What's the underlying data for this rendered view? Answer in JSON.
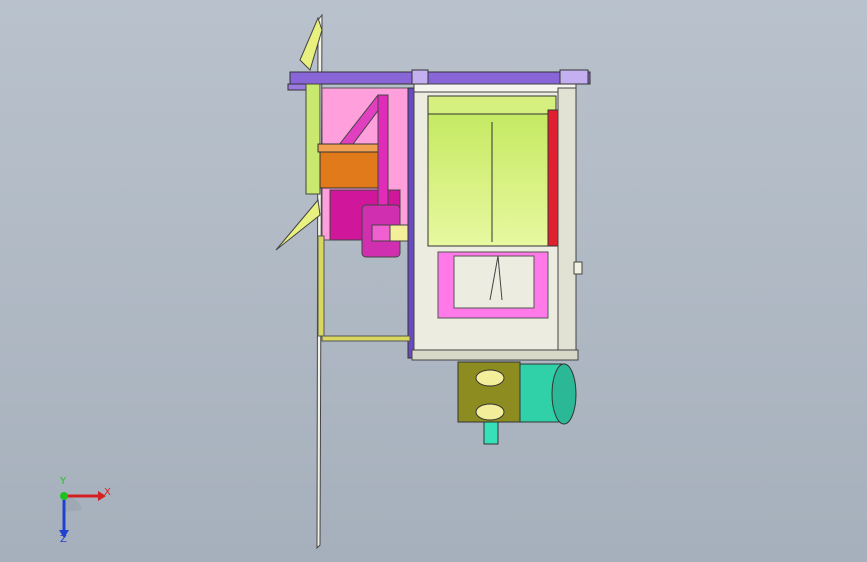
{
  "viewport": {
    "background_top": "#b9c2cc",
    "background_bottom": "#a6b0bc"
  },
  "model": {
    "name": "",
    "colors": {
      "frame_purple": "#7a5cc8",
      "hopper_green": "#b8e84a",
      "pink": "#ff8fd6",
      "magenta": "#d0169a",
      "orange": "#e07a1a",
      "olive": "#8a8a1e",
      "teal": "#28c8a0",
      "cream": "#e8e8d8",
      "yellow_rod": "#d8d860"
    }
  },
  "triad": {
    "x_label": "X",
    "y_label": "Y",
    "z_label": "Z",
    "x_color": "#d42020",
    "y_color": "#20c020",
    "z_color": "#2040d0"
  }
}
